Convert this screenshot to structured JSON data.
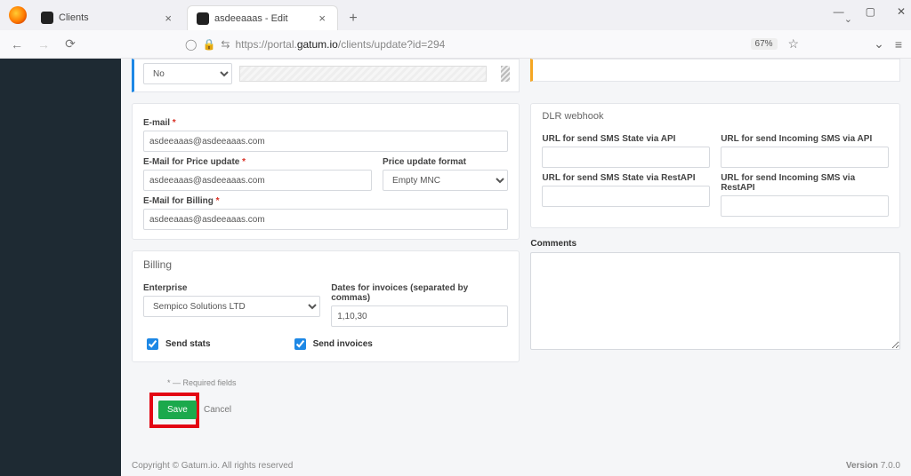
{
  "browser": {
    "tabs": [
      {
        "title": "Clients",
        "active": false
      },
      {
        "title": "asdeeaaas - Edit",
        "active": true
      }
    ],
    "url_prefix": "https://portal.",
    "url_highlight": "gatum.io",
    "url_suffix": "/clients/update?id=294",
    "zoom": "67%"
  },
  "top_select_value": "No",
  "email_section": {
    "email_label": "E-mail",
    "email_value": "asdeeaaas@asdeeaaas.com",
    "price_label": "E-Mail for Price update",
    "price_value": "asdeeaaas@asdeeaaas.com",
    "format_label": "Price update format",
    "format_value": "Empty MNC",
    "billing_label": "E-Mail for Billing",
    "billing_value": "asdeeaaas@asdeeaaas.com"
  },
  "dlr": {
    "title": "DLR webhook",
    "col1a": "URL for send SMS State via API",
    "col2a": "URL for send Incoming SMS via API",
    "col1b": "URL for send SMS State via RestAPI",
    "col2b": "URL for send Incoming SMS via RestAPI"
  },
  "billing": {
    "title": "Billing",
    "enterprise_label": "Enterprise",
    "enterprise_value": "Sempico Solutions LTD",
    "dates_label": "Dates for invoices (separated by commas)",
    "dates_value": "1,10,30",
    "send_stats": "Send stats",
    "send_invoices": "Send invoices"
  },
  "comments_label": "Comments",
  "required_text": "* — Required fields",
  "buttons": {
    "save": "Save",
    "cancel": "Cancel"
  },
  "footer": {
    "copyright": "Copyright © Gatum.io. All rights reserved",
    "version_label": "Version",
    "version": "7.0.0"
  }
}
